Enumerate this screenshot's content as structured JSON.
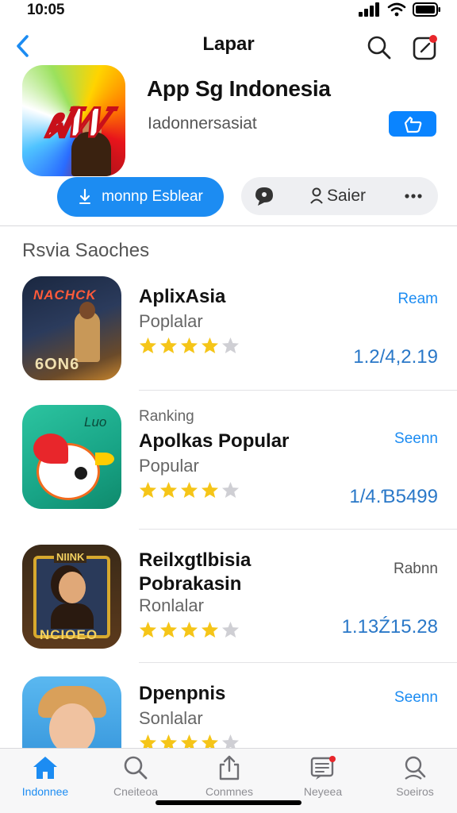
{
  "status_bar": {
    "time": "10:05"
  },
  "nav": {
    "title": "Lapar"
  },
  "app": {
    "name": "App Sg Indonesia",
    "subtitle": "Iadonnersasiat",
    "primary_button": "monnp Esblear",
    "secondary_button": "Saier"
  },
  "section": {
    "title": "Rsvia Saoches"
  },
  "rows": [
    {
      "lines": [
        "AplixAsia",
        "Poplalar"
      ],
      "action": "Ream",
      "count": "1.2/4,2.19",
      "rating": 4,
      "icon_text": [
        "NACHCK",
        "6ON6"
      ]
    },
    {
      "lines": [
        "Ranking",
        "Apolkas Popular",
        "Popular"
      ],
      "action": "Seenn",
      "count": "1/4.Ɓ5499",
      "rating": 4,
      "icon_text": [
        "Luo"
      ]
    },
    {
      "lines": [
        "Reilxgtlbisia",
        "Pobrakasin",
        "Ronlalar"
      ],
      "action": "Rabnn",
      "count": "1.13Ź15.28",
      "rating": 4,
      "icon_text": [
        "NIINK",
        "NCIOEO"
      ]
    },
    {
      "lines": [
        "Dpenpnis",
        "Sonlalar"
      ],
      "action": "Seenn",
      "count": "",
      "rating": 4,
      "icon_text": []
    }
  ],
  "tabs": [
    {
      "label": "Indonnee",
      "icon": "home-icon",
      "active": true
    },
    {
      "label": "Cneiteoa",
      "icon": "search-icon",
      "active": false
    },
    {
      "label": "Conmnes",
      "icon": "share-icon",
      "active": false
    },
    {
      "label": "Neyeea",
      "icon": "news-icon",
      "active": false
    },
    {
      "label": "Soeiros",
      "icon": "search-person-icon",
      "active": false
    }
  ],
  "colors": {
    "accent": "#1c8cf2",
    "star": "#f5c518",
    "star_empty": "#cfcfd4",
    "badge_red": "#e8262b"
  }
}
